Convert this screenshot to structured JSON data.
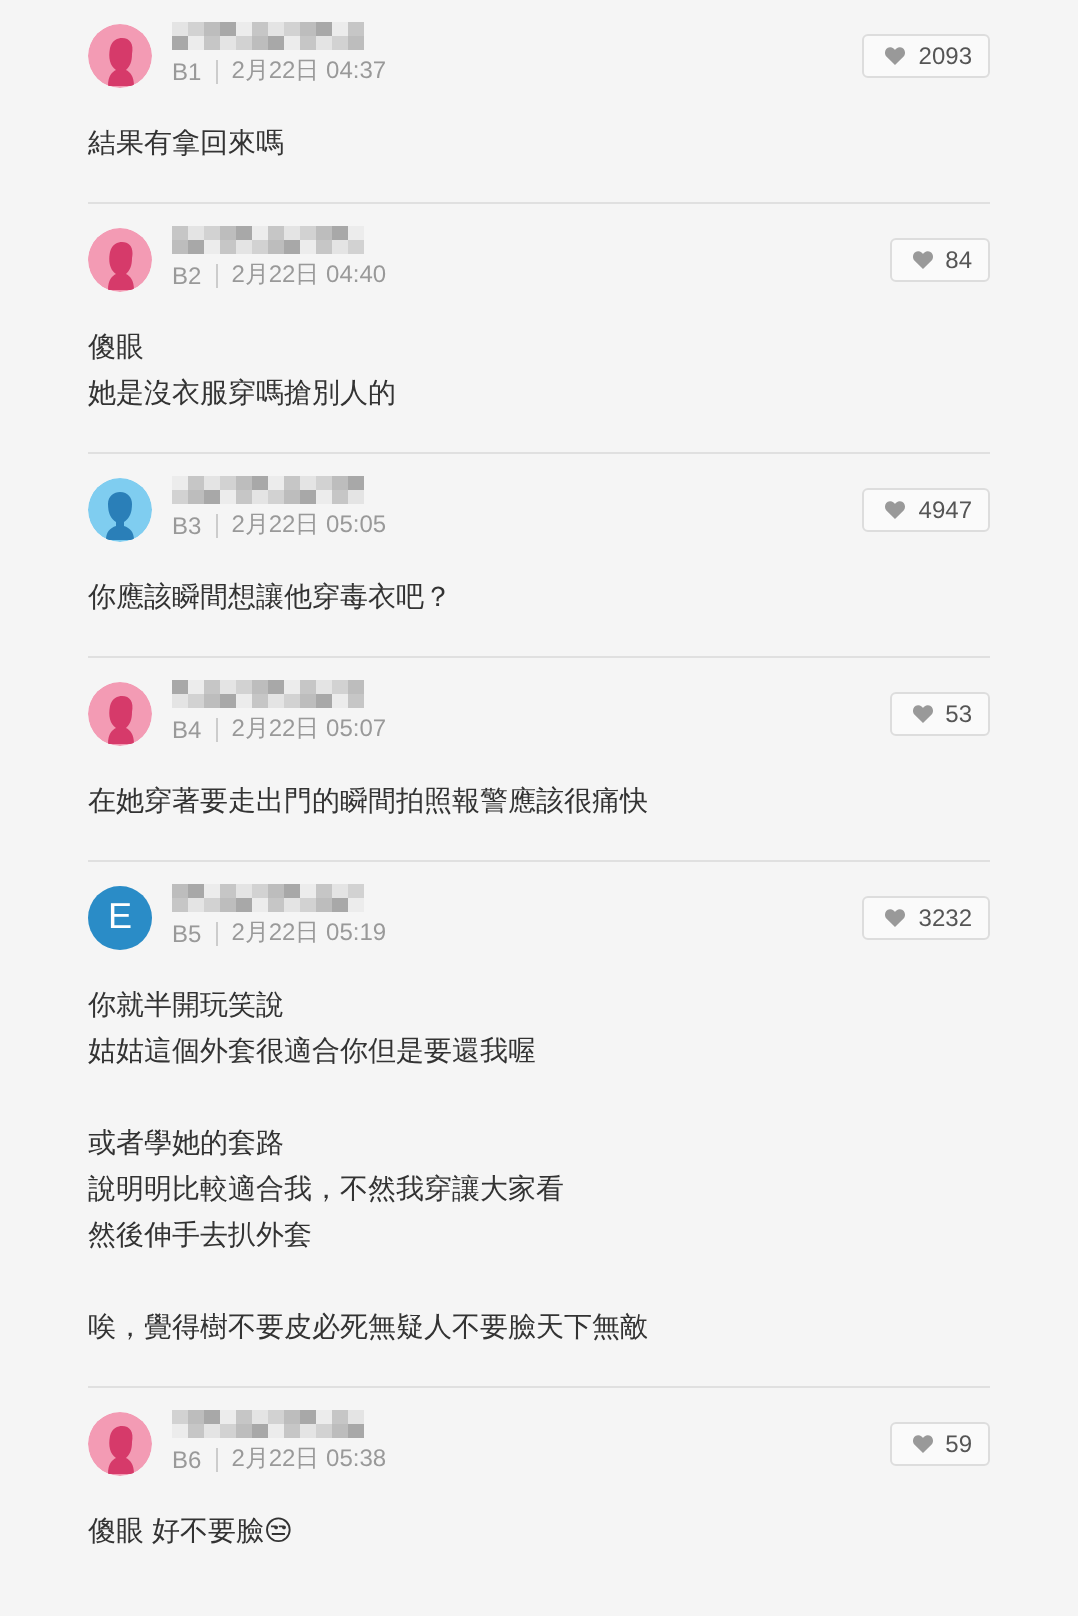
{
  "comments": [
    {
      "avatar": {
        "kind": "female"
      },
      "floor": "B1",
      "time": "2月22日 04:37",
      "likes": "2093",
      "paragraphs": [
        [
          "結果有拿回來嗎"
        ]
      ]
    },
    {
      "avatar": {
        "kind": "female"
      },
      "floor": "B2",
      "time": "2月22日 04:40",
      "likes": "84",
      "paragraphs": [
        [
          "傻眼",
          "她是沒衣服穿嗎搶別人的"
        ]
      ]
    },
    {
      "avatar": {
        "kind": "male"
      },
      "floor": "B3",
      "time": "2月22日 05:05",
      "likes": "4947",
      "paragraphs": [
        [
          "你應該瞬間想讓他穿毒衣吧？"
        ]
      ]
    },
    {
      "avatar": {
        "kind": "female"
      },
      "floor": "B4",
      "time": "2月22日 05:07",
      "likes": "53",
      "paragraphs": [
        [
          "在她穿著要走出門的瞬間拍照報警應該很痛快"
        ]
      ]
    },
    {
      "avatar": {
        "kind": "letter",
        "letter": "E"
      },
      "floor": "B5",
      "time": "2月22日 05:19",
      "likes": "3232",
      "paragraphs": [
        [
          "你就半開玩笑說",
          "姑姑這個外套很適合你但是要還我喔"
        ],
        [
          "或者學她的套路",
          "說明明比較適合我，不然我穿讓大家看",
          "然後伸手去扒外套"
        ],
        [
          "唉，覺得樹不要皮必死無疑人不要臉天下無敵"
        ]
      ]
    },
    {
      "avatar": {
        "kind": "female"
      },
      "floor": "B6",
      "time": "2月22日 05:38",
      "likes": "59",
      "paragraphs": [
        [
          "傻眼 好不要臉😒"
        ]
      ]
    }
  ]
}
